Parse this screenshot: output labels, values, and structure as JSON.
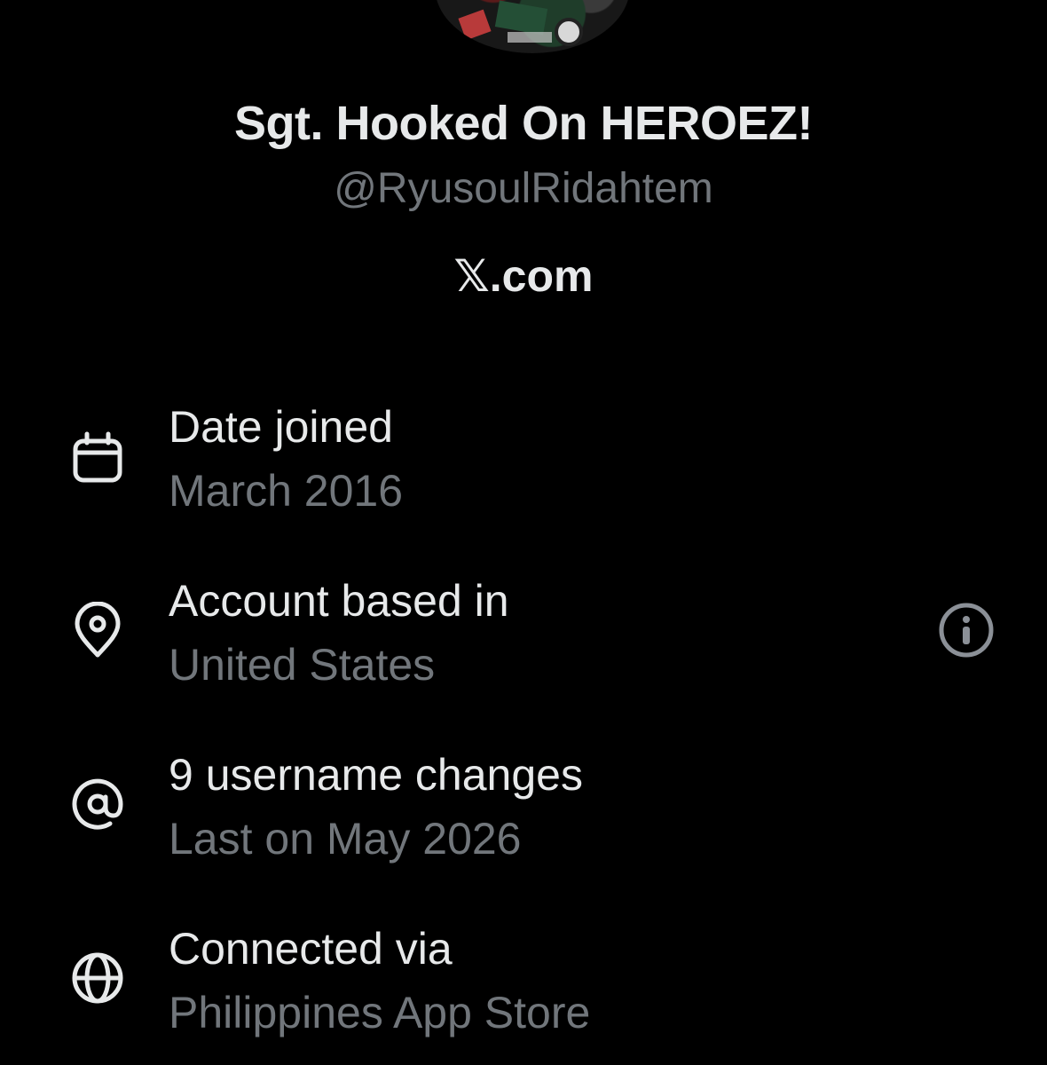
{
  "profile": {
    "display_name": "Sgt. Hooked On HEROEZ!",
    "handle": "@RyusoulRidahtem",
    "source_link": "𝕏.com"
  },
  "rows": [
    {
      "icon": "calendar-icon",
      "title": "Date joined",
      "value": "March 2016"
    },
    {
      "icon": "location-pin-icon",
      "title": "Account based in",
      "value": "United States"
    },
    {
      "icon": "at-sign-icon",
      "title": "9 username changes",
      "value": "Last on May 2026"
    },
    {
      "icon": "globe-icon",
      "title": "Connected via",
      "value": "Philippines App Store"
    }
  ],
  "colors": {
    "background": "#000000",
    "primary_text": "#e7e9ea",
    "secondary_text": "#71767b"
  }
}
